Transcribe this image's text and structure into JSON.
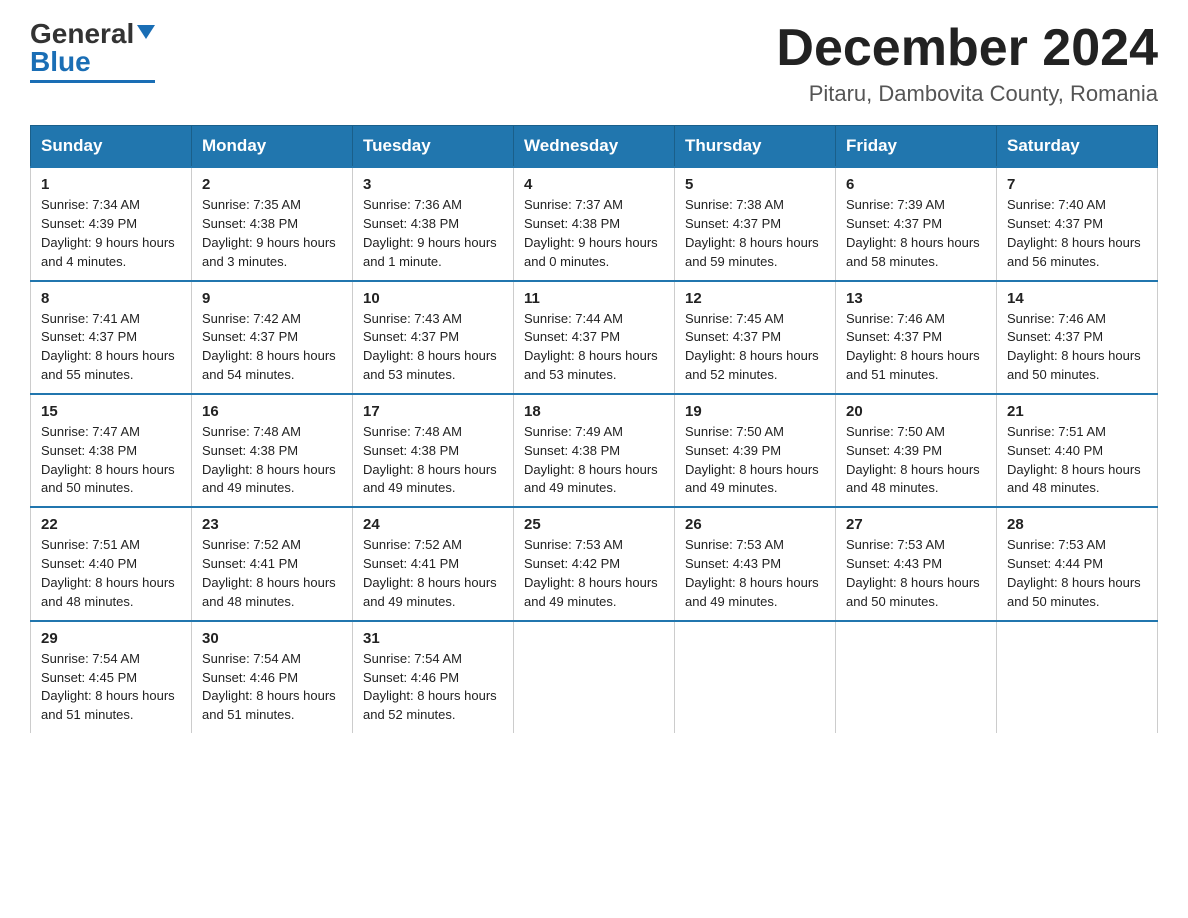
{
  "logo": {
    "general": "General",
    "blue": "Blue"
  },
  "title": "December 2024",
  "location": "Pitaru, Dambovita County, Romania",
  "days_of_week": [
    "Sunday",
    "Monday",
    "Tuesday",
    "Wednesday",
    "Thursday",
    "Friday",
    "Saturday"
  ],
  "weeks": [
    [
      {
        "day": "1",
        "sunrise": "7:34 AM",
        "sunset": "4:39 PM",
        "daylight": "9 hours and 4 minutes."
      },
      {
        "day": "2",
        "sunrise": "7:35 AM",
        "sunset": "4:38 PM",
        "daylight": "9 hours and 3 minutes."
      },
      {
        "day": "3",
        "sunrise": "7:36 AM",
        "sunset": "4:38 PM",
        "daylight": "9 hours and 1 minute."
      },
      {
        "day": "4",
        "sunrise": "7:37 AM",
        "sunset": "4:38 PM",
        "daylight": "9 hours and 0 minutes."
      },
      {
        "day": "5",
        "sunrise": "7:38 AM",
        "sunset": "4:37 PM",
        "daylight": "8 hours and 59 minutes."
      },
      {
        "day": "6",
        "sunrise": "7:39 AM",
        "sunset": "4:37 PM",
        "daylight": "8 hours and 58 minutes."
      },
      {
        "day": "7",
        "sunrise": "7:40 AM",
        "sunset": "4:37 PM",
        "daylight": "8 hours and 56 minutes."
      }
    ],
    [
      {
        "day": "8",
        "sunrise": "7:41 AM",
        "sunset": "4:37 PM",
        "daylight": "8 hours and 55 minutes."
      },
      {
        "day": "9",
        "sunrise": "7:42 AM",
        "sunset": "4:37 PM",
        "daylight": "8 hours and 54 minutes."
      },
      {
        "day": "10",
        "sunrise": "7:43 AM",
        "sunset": "4:37 PM",
        "daylight": "8 hours and 53 minutes."
      },
      {
        "day": "11",
        "sunrise": "7:44 AM",
        "sunset": "4:37 PM",
        "daylight": "8 hours and 53 minutes."
      },
      {
        "day": "12",
        "sunrise": "7:45 AM",
        "sunset": "4:37 PM",
        "daylight": "8 hours and 52 minutes."
      },
      {
        "day": "13",
        "sunrise": "7:46 AM",
        "sunset": "4:37 PM",
        "daylight": "8 hours and 51 minutes."
      },
      {
        "day": "14",
        "sunrise": "7:46 AM",
        "sunset": "4:37 PM",
        "daylight": "8 hours and 50 minutes."
      }
    ],
    [
      {
        "day": "15",
        "sunrise": "7:47 AM",
        "sunset": "4:38 PM",
        "daylight": "8 hours and 50 minutes."
      },
      {
        "day": "16",
        "sunrise": "7:48 AM",
        "sunset": "4:38 PM",
        "daylight": "8 hours and 49 minutes."
      },
      {
        "day": "17",
        "sunrise": "7:48 AM",
        "sunset": "4:38 PM",
        "daylight": "8 hours and 49 minutes."
      },
      {
        "day": "18",
        "sunrise": "7:49 AM",
        "sunset": "4:38 PM",
        "daylight": "8 hours and 49 minutes."
      },
      {
        "day": "19",
        "sunrise": "7:50 AM",
        "sunset": "4:39 PM",
        "daylight": "8 hours and 49 minutes."
      },
      {
        "day": "20",
        "sunrise": "7:50 AM",
        "sunset": "4:39 PM",
        "daylight": "8 hours and 48 minutes."
      },
      {
        "day": "21",
        "sunrise": "7:51 AM",
        "sunset": "4:40 PM",
        "daylight": "8 hours and 48 minutes."
      }
    ],
    [
      {
        "day": "22",
        "sunrise": "7:51 AM",
        "sunset": "4:40 PM",
        "daylight": "8 hours and 48 minutes."
      },
      {
        "day": "23",
        "sunrise": "7:52 AM",
        "sunset": "4:41 PM",
        "daylight": "8 hours and 48 minutes."
      },
      {
        "day": "24",
        "sunrise": "7:52 AM",
        "sunset": "4:41 PM",
        "daylight": "8 hours and 49 minutes."
      },
      {
        "day": "25",
        "sunrise": "7:53 AM",
        "sunset": "4:42 PM",
        "daylight": "8 hours and 49 minutes."
      },
      {
        "day": "26",
        "sunrise": "7:53 AM",
        "sunset": "4:43 PM",
        "daylight": "8 hours and 49 minutes."
      },
      {
        "day": "27",
        "sunrise": "7:53 AM",
        "sunset": "4:43 PM",
        "daylight": "8 hours and 50 minutes."
      },
      {
        "day": "28",
        "sunrise": "7:53 AM",
        "sunset": "4:44 PM",
        "daylight": "8 hours and 50 minutes."
      }
    ],
    [
      {
        "day": "29",
        "sunrise": "7:54 AM",
        "sunset": "4:45 PM",
        "daylight": "8 hours and 51 minutes."
      },
      {
        "day": "30",
        "sunrise": "7:54 AM",
        "sunset": "4:46 PM",
        "daylight": "8 hours and 51 minutes."
      },
      {
        "day": "31",
        "sunrise": "7:54 AM",
        "sunset": "4:46 PM",
        "daylight": "8 hours and 52 minutes."
      },
      null,
      null,
      null,
      null
    ]
  ],
  "labels": {
    "sunrise": "Sunrise:",
    "sunset": "Sunset:",
    "daylight": "Daylight:"
  }
}
